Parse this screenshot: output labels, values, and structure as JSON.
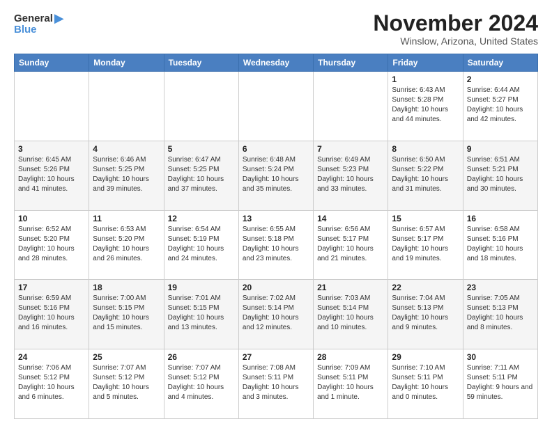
{
  "header": {
    "logo_general": "General",
    "logo_blue": "Blue",
    "month_title": "November 2024",
    "location": "Winslow, Arizona, United States"
  },
  "weekdays": [
    "Sunday",
    "Monday",
    "Tuesday",
    "Wednesday",
    "Thursday",
    "Friday",
    "Saturday"
  ],
  "weeks": [
    [
      {
        "day": "",
        "info": ""
      },
      {
        "day": "",
        "info": ""
      },
      {
        "day": "",
        "info": ""
      },
      {
        "day": "",
        "info": ""
      },
      {
        "day": "",
        "info": ""
      },
      {
        "day": "1",
        "info": "Sunrise: 6:43 AM\nSunset: 5:28 PM\nDaylight: 10 hours and 44 minutes."
      },
      {
        "day": "2",
        "info": "Sunrise: 6:44 AM\nSunset: 5:27 PM\nDaylight: 10 hours and 42 minutes."
      }
    ],
    [
      {
        "day": "3",
        "info": "Sunrise: 6:45 AM\nSunset: 5:26 PM\nDaylight: 10 hours and 41 minutes."
      },
      {
        "day": "4",
        "info": "Sunrise: 6:46 AM\nSunset: 5:25 PM\nDaylight: 10 hours and 39 minutes."
      },
      {
        "day": "5",
        "info": "Sunrise: 6:47 AM\nSunset: 5:25 PM\nDaylight: 10 hours and 37 minutes."
      },
      {
        "day": "6",
        "info": "Sunrise: 6:48 AM\nSunset: 5:24 PM\nDaylight: 10 hours and 35 minutes."
      },
      {
        "day": "7",
        "info": "Sunrise: 6:49 AM\nSunset: 5:23 PM\nDaylight: 10 hours and 33 minutes."
      },
      {
        "day": "8",
        "info": "Sunrise: 6:50 AM\nSunset: 5:22 PM\nDaylight: 10 hours and 31 minutes."
      },
      {
        "day": "9",
        "info": "Sunrise: 6:51 AM\nSunset: 5:21 PM\nDaylight: 10 hours and 30 minutes."
      }
    ],
    [
      {
        "day": "10",
        "info": "Sunrise: 6:52 AM\nSunset: 5:20 PM\nDaylight: 10 hours and 28 minutes."
      },
      {
        "day": "11",
        "info": "Sunrise: 6:53 AM\nSunset: 5:20 PM\nDaylight: 10 hours and 26 minutes."
      },
      {
        "day": "12",
        "info": "Sunrise: 6:54 AM\nSunset: 5:19 PM\nDaylight: 10 hours and 24 minutes."
      },
      {
        "day": "13",
        "info": "Sunrise: 6:55 AM\nSunset: 5:18 PM\nDaylight: 10 hours and 23 minutes."
      },
      {
        "day": "14",
        "info": "Sunrise: 6:56 AM\nSunset: 5:17 PM\nDaylight: 10 hours and 21 minutes."
      },
      {
        "day": "15",
        "info": "Sunrise: 6:57 AM\nSunset: 5:17 PM\nDaylight: 10 hours and 19 minutes."
      },
      {
        "day": "16",
        "info": "Sunrise: 6:58 AM\nSunset: 5:16 PM\nDaylight: 10 hours and 18 minutes."
      }
    ],
    [
      {
        "day": "17",
        "info": "Sunrise: 6:59 AM\nSunset: 5:16 PM\nDaylight: 10 hours and 16 minutes."
      },
      {
        "day": "18",
        "info": "Sunrise: 7:00 AM\nSunset: 5:15 PM\nDaylight: 10 hours and 15 minutes."
      },
      {
        "day": "19",
        "info": "Sunrise: 7:01 AM\nSunset: 5:15 PM\nDaylight: 10 hours and 13 minutes."
      },
      {
        "day": "20",
        "info": "Sunrise: 7:02 AM\nSunset: 5:14 PM\nDaylight: 10 hours and 12 minutes."
      },
      {
        "day": "21",
        "info": "Sunrise: 7:03 AM\nSunset: 5:14 PM\nDaylight: 10 hours and 10 minutes."
      },
      {
        "day": "22",
        "info": "Sunrise: 7:04 AM\nSunset: 5:13 PM\nDaylight: 10 hours and 9 minutes."
      },
      {
        "day": "23",
        "info": "Sunrise: 7:05 AM\nSunset: 5:13 PM\nDaylight: 10 hours and 8 minutes."
      }
    ],
    [
      {
        "day": "24",
        "info": "Sunrise: 7:06 AM\nSunset: 5:12 PM\nDaylight: 10 hours and 6 minutes."
      },
      {
        "day": "25",
        "info": "Sunrise: 7:07 AM\nSunset: 5:12 PM\nDaylight: 10 hours and 5 minutes."
      },
      {
        "day": "26",
        "info": "Sunrise: 7:07 AM\nSunset: 5:12 PM\nDaylight: 10 hours and 4 minutes."
      },
      {
        "day": "27",
        "info": "Sunrise: 7:08 AM\nSunset: 5:11 PM\nDaylight: 10 hours and 3 minutes."
      },
      {
        "day": "28",
        "info": "Sunrise: 7:09 AM\nSunset: 5:11 PM\nDaylight: 10 hours and 1 minute."
      },
      {
        "day": "29",
        "info": "Sunrise: 7:10 AM\nSunset: 5:11 PM\nDaylight: 10 hours and 0 minutes."
      },
      {
        "day": "30",
        "info": "Sunrise: 7:11 AM\nSunset: 5:11 PM\nDaylight: 9 hours and 59 minutes."
      }
    ]
  ],
  "row_shading": [
    false,
    true,
    false,
    true,
    false
  ]
}
